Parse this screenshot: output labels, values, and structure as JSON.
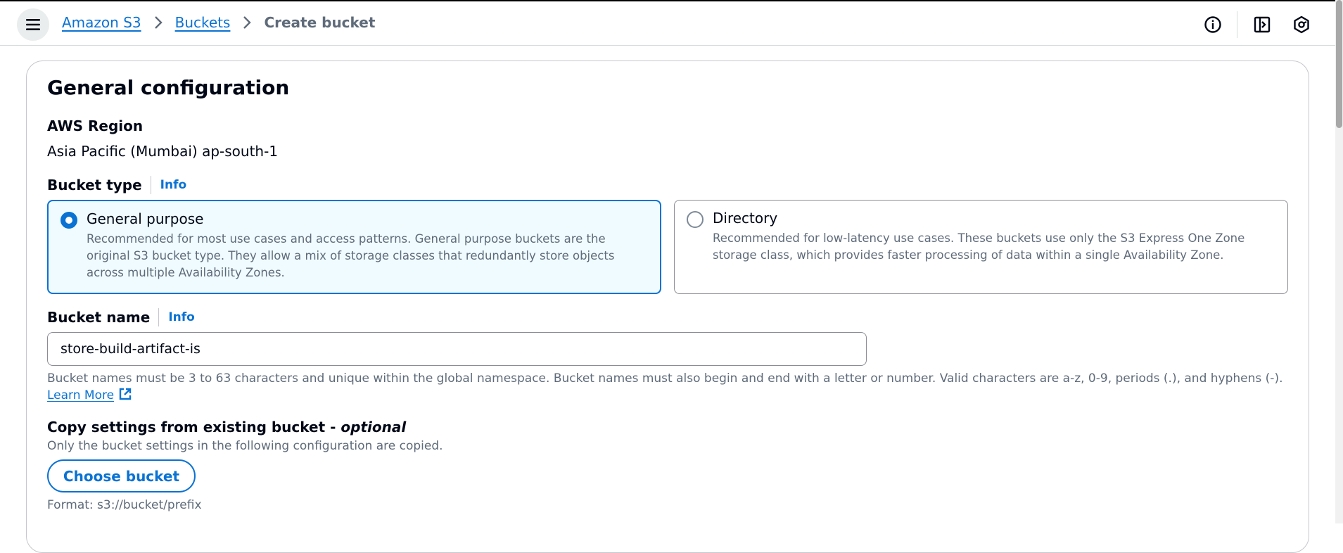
{
  "breadcrumb": {
    "items": [
      "Amazon S3",
      "Buckets"
    ],
    "current": "Create bucket"
  },
  "icons": {
    "menu": "hamburger-menu-icon",
    "info": "info-circle-icon",
    "notifications": "notification-panel-icon",
    "settings": "hexagon-gear-icon",
    "external": "external-link-icon"
  },
  "section": {
    "title": "General configuration"
  },
  "region": {
    "label": "AWS Region",
    "value": "Asia Pacific (Mumbai) ap-south-1"
  },
  "bucket_type": {
    "label": "Bucket type",
    "info": "Info",
    "options": [
      {
        "title": "General purpose",
        "description": "Recommended for most use cases and access patterns. General purpose buckets are the original S3 bucket type. They allow a mix of storage classes that redundantly store objects across multiple Availability Zones.",
        "selected": true
      },
      {
        "title": "Directory",
        "description": "Recommended for low-latency use cases. These buckets use only the S3 Express One Zone storage class, which provides faster processing of data within a single Availability Zone.",
        "selected": false
      }
    ]
  },
  "bucket_name": {
    "label": "Bucket name",
    "info": "Info",
    "value": "store-build-artifact-is",
    "hint": "Bucket names must be 3 to 63 characters and unique within the global namespace. Bucket names must also begin and end with a letter or number. Valid characters are a-z, 0-9, periods (.), and hyphens (-).",
    "learn_more": "Learn More"
  },
  "copy_settings": {
    "label": "Copy settings from existing bucket - ",
    "label_optional": "optional",
    "description": "Only the bucket settings in the following configuration are copied.",
    "button": "Choose bucket",
    "format": "Format: s3://bucket/prefix"
  },
  "colors": {
    "accent": "#0972d3",
    "selected_bg": "#f0fbff",
    "muted_text": "#5f6b7a"
  }
}
